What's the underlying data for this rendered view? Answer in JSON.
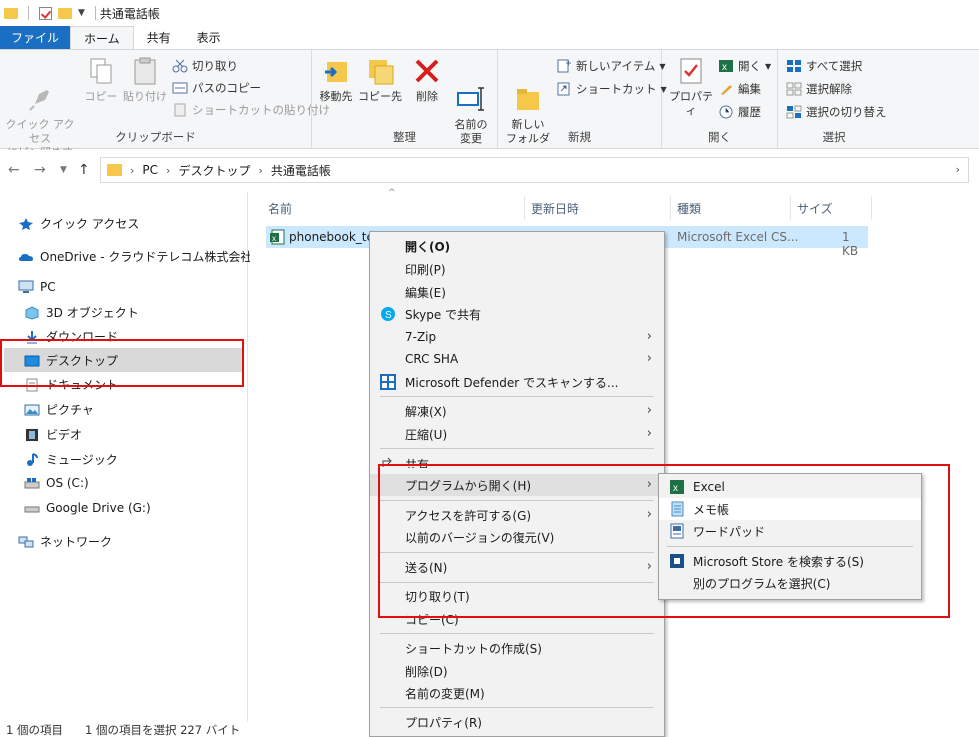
{
  "window": {
    "title": "共通電話帳"
  },
  "tabs": [
    {
      "label": "ファイル"
    },
    {
      "label": "ホーム"
    },
    {
      "label": "共有"
    },
    {
      "label": "表示"
    }
  ],
  "ribbon": {
    "clipboard": {
      "pin": "クイック アクセス\nにピン留めする",
      "copy": "コピー",
      "paste": "貼り付け",
      "cut": "切り取り",
      "copy_path": "パスのコピー",
      "paste_shortcut": "ショートカットの貼り付け",
      "label": "クリップボード"
    },
    "organize": {
      "move": "移動先",
      "copy_to": "コピー先",
      "delete": "削除",
      "rename": "名前の\n変更",
      "label": "整理"
    },
    "new": {
      "new_folder": "新しい\nフォルダー",
      "new_item": "新しいアイテム",
      "shortcut": "ショートカット",
      "label": "新規"
    },
    "open": {
      "properties": "プロパティ",
      "open": "開く",
      "edit": "編集",
      "history": "履歴",
      "label": "開く"
    },
    "select": {
      "select_all": "すべて選択",
      "select_none": "選択解除",
      "invert": "選択の切り替え",
      "label": "選択"
    }
  },
  "address": {
    "crumbs": [
      "PC",
      "デスクトップ",
      "共通電話帳"
    ]
  },
  "nav": {
    "quick_access": "クイック アクセス",
    "onedrive": "OneDrive - クラウドテレコム株式会社",
    "pc": "PC",
    "objects3d": "3D オブジェクト",
    "downloads": "ダウンロード",
    "desktop": "デスクトップ",
    "documents": "ドキュメント",
    "pictures": "ピクチャ",
    "videos": "ビデオ",
    "music": "ミュージック",
    "os": "OS (C:)",
    "gdrive": "Google Drive (G:)",
    "network": "ネットワーク"
  },
  "columns": {
    "name": "名前",
    "modified": "更新日時",
    "type": "種類",
    "size": "サイズ"
  },
  "file": {
    "name": "phonebook_tes",
    "type": "Microsoft Excel CS...",
    "size": "1 KB"
  },
  "status": {
    "count": "1 個の項目",
    "selected": "1 個の項目を選択  227 バイト"
  },
  "context_menu": {
    "open": "開く(O)",
    "print": "印刷(P)",
    "edit": "編集(E)",
    "skype": "Skype で共有",
    "zip7": "7-Zip",
    "crc": "CRC SHA",
    "defender": "Microsoft Defender でスキャンする...",
    "extract": "解凍(X)",
    "compress": "圧縮(U)",
    "share": "共有",
    "open_with": "プログラムから開く(H)",
    "give_access": "アクセスを許可する(G)",
    "restore": "以前のバージョンの復元(V)",
    "send_to": "送る(N)",
    "cut": "切り取り(T)",
    "copy": "コピー(C)",
    "create_shortcut": "ショートカットの作成(S)",
    "delete": "削除(D)",
    "rename": "名前の変更(M)",
    "properties": "プロパティ(R)"
  },
  "submenu": {
    "excel": "Excel",
    "notepad": "メモ帳",
    "wordpad": "ワードパッド",
    "store": "Microsoft Store を検索する(S)",
    "choose": "別のプログラムを選択(C)"
  },
  "colors": {
    "accent": "#1b6fc2",
    "highlight": "#e01010",
    "selection": "#cce8ff"
  }
}
